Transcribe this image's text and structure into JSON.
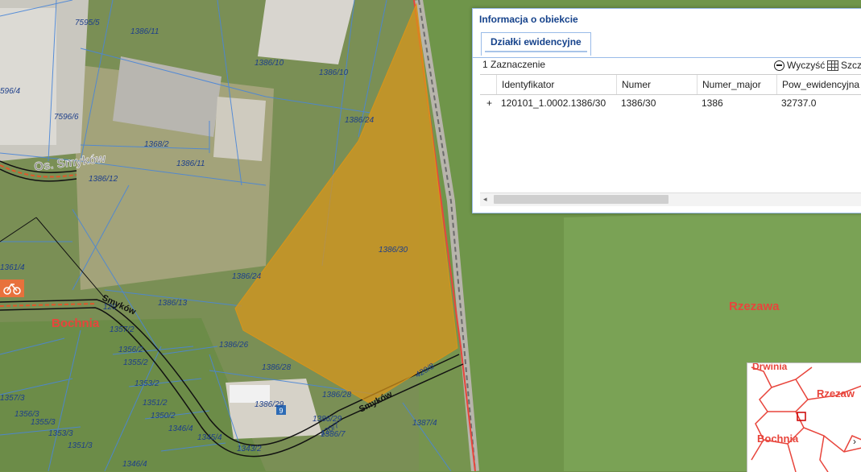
{
  "map": {
    "parcel_labels": [
      "7595/5",
      "1386/11",
      "1386/10",
      "1386/10",
      "596/4",
      "7596/6",
      "1386/24",
      "1368/2",
      "1386/11",
      "1386/12",
      "1386/30",
      "1361/4",
      "1386/24",
      "1386/13",
      "1357/2",
      "1356/2",
      "1355/2",
      "1353/2",
      "1351/2",
      "1350/2",
      "1346/4",
      "1345/4",
      "1343/2",
      "1386/26",
      "1386/28",
      "1386/28",
      "1386/29",
      "1386/29",
      "1386/7",
      "1387/4",
      "1351/3",
      "1353/3",
      "1355/3",
      "1357/3",
      "1346/4",
      "129",
      "420/8",
      "420/7",
      "1356/3"
    ],
    "place_names": {
      "os_smykow": "Os. Smyków",
      "bochnia": "Bochnia",
      "rzezawa": "Rzezawa"
    },
    "road_labels": {
      "smykow_1": "Smyków",
      "smykow_2": "Smyków"
    },
    "poi_badge": "9",
    "colors": {
      "selected_parcel": "#d9951a",
      "border_red": "#e8453c",
      "parcel_line": "#4a86d8"
    }
  },
  "info_panel": {
    "title": "Informacja o obiekcie",
    "tab": "Działki ewidencyjne",
    "selection_count": "1 Zaznaczenie",
    "clear_label": "Wyczyść",
    "details_label": "Szcz",
    "columns": [
      "Identyfikator",
      "Numer",
      "Numer_major",
      "Pow_ewidencyjna"
    ],
    "rows": [
      {
        "expand": "+",
        "cells": [
          "120101_1.0002.1386/30",
          "1386/30",
          "1386",
          "32737.0"
        ]
      }
    ],
    "scroll_left_icon": "arrow-left-icon"
  },
  "minimap": {
    "labels": {
      "drwinia": "Drwinia",
      "rzezawa": "Rzezaw",
      "bochnia": "Bochnia"
    },
    "next_icon": "chevron-right-icon",
    "next_label": "›"
  }
}
